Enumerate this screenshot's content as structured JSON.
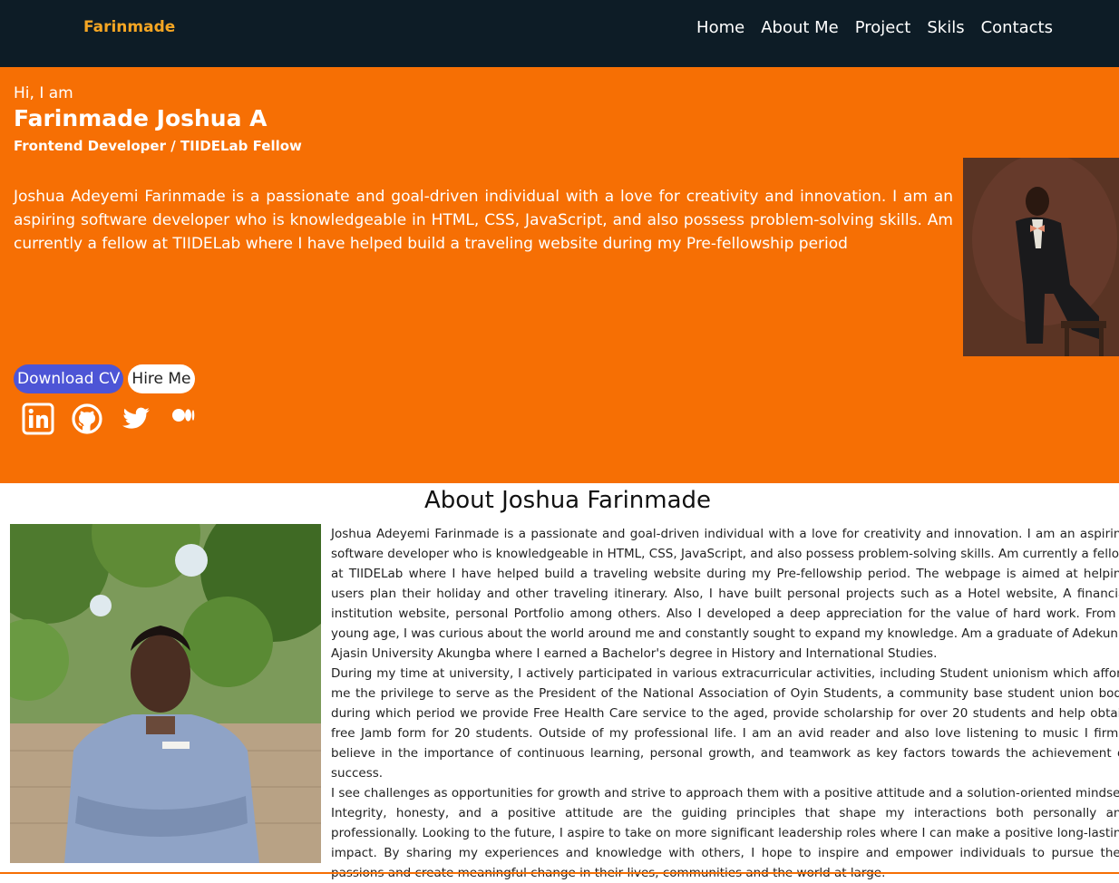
{
  "nav": {
    "brand": "Farinmade",
    "links": [
      "Home",
      "About Me",
      "Project",
      "Skils",
      "Contacts"
    ]
  },
  "hero": {
    "greeting": "Hi, I am",
    "name": "Farinmade Joshua A",
    "role": "Frontend Developer / TIIDELab Fellow",
    "bio": "Joshua Adeyemi Farinmade is a passionate and goal-driven individual with a love for creativity and innovation. I am an aspiring software developer who is knowledgeable in HTML, CSS, JavaScript, and also possess problem-solving skills. Am currently a fellow at TIIDELab where I have helped build a traveling website during my Pre-fellowship period",
    "download_label": "Download CV",
    "hire_label": "Hire Me",
    "socials": [
      "linkedin-icon",
      "github-icon",
      "twitter-icon",
      "medium-icon"
    ]
  },
  "about": {
    "title": "About Joshua Farinmade",
    "paragraphs": [
      "Joshua Adeyemi Farinmade is a passionate and goal-driven individual with a love for creativity and innovation. I am an aspiring software developer who is knowledgeable in HTML, CSS, JavaScript, and also possess problem-solving skills. Am currently a fellow at TIIDELab where I have helped build a traveling website during my Pre-fellowship period. The webpage is aimed at helping users plan their holiday and other traveling itinerary. Also, I have built personal projects such as a Hotel website, A financial institution website, personal Portfolio among others. Also I developed a deep appreciation for the value of hard work. From a young age, I was curious about the world around me and constantly sought to expand my knowledge. Am a graduate of Adekunle Ajasin University Akungba where I earned a Bachelor's degree in History and International Studies.",
      "During my time at university, I actively participated in various extracurricular activities, including Student unionism which afford me the privilege to serve as the President of the National Association of Oyin Students, a community base student union body during which period we provide Free Health Care service to the aged, provide scholarship for over 20 students and help obtain free Jamb form for 20 students. Outside of my professional life. I am an avid reader and also love listening to music I firmly believe in the importance of continuous learning, personal growth, and teamwork as key factors towards the achievement of success.",
      "I see challenges as opportunities for growth and strive to approach them with a positive attitude and a solution-oriented mindset. Integrity, honesty, and a positive attitude are the guiding principles that shape my interactions both personally and professionally. Looking to the future, I aspire to take on more significant leadership roles where I can make a positive long-lasting impact. By sharing my experiences and knowledge with others, I hope to inspire and empower individuals to pursue their passions and create meaningful change in their lives, communities and the world at large."
    ]
  },
  "colors": {
    "nav_bg": "#0d1c26",
    "brand": "#f5a623",
    "hero_bg": "#f66f04",
    "cv_button": "#4d55d6"
  }
}
